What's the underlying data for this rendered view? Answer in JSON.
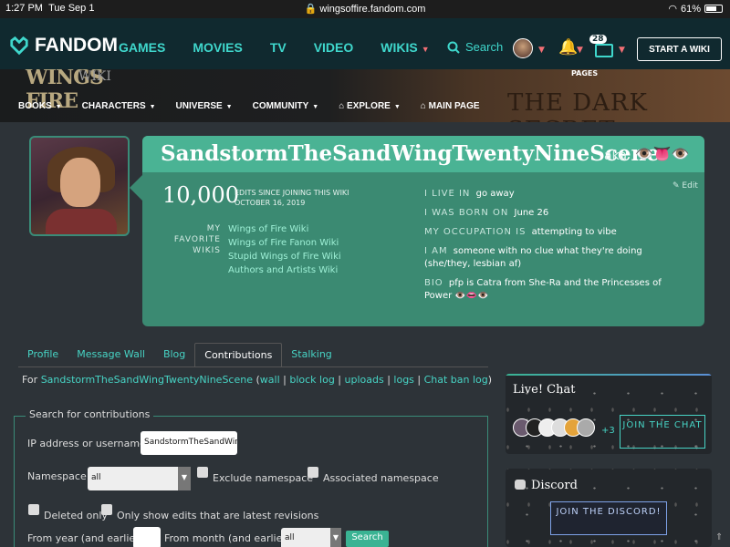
{
  "status_bar": {
    "time": "1:27 PM",
    "date": "Tue Sep 1",
    "url": "wingsoffire.fandom.com",
    "battery": "61%"
  },
  "fandom_bar": {
    "logo": "FANDOM",
    "nav": [
      "GAMES",
      "MOVIES",
      "TV",
      "VIDEO",
      "WIKIS"
    ],
    "search_label": "Search",
    "notifications_count": "28",
    "start_wiki": "START A WIKI"
  },
  "community": {
    "logo_top": "WINGS",
    "logo_bottom": "FIRE",
    "logo_wiki": "WIKI",
    "pages_label": "PAGES",
    "banner_text": "THE DARK SECRET",
    "nav": [
      "BOOKS",
      "CHARACTERS",
      "UNIVERSE",
      "COMMUNITY",
      "EXPLORE",
      "MAIN PAGE"
    ]
  },
  "profile": {
    "username": "SandstormTheSandWingTwentyNineScene",
    "aka": "aka",
    "aka_emoji": "👁️👅👁️",
    "edits_count": "10,000",
    "edits_label": "EDITS SINCE JOINING THIS WIKI",
    "join_date": "OCTOBER 16, 2019",
    "favorite_label": "MY FAVORITE WIKIS",
    "favorite_wikis": [
      "Wings of Fire Wiki",
      "Wings of Fire Fanon Wiki",
      "Stupid Wings of Fire Wiki",
      "Authors and Artists Wiki"
    ],
    "edit_link": "Edit",
    "facts": [
      {
        "key": "I LIVE IN",
        "value": "go away"
      },
      {
        "key": "I WAS BORN ON",
        "value": "June 26"
      },
      {
        "key": "MY OCCUPATION IS",
        "value": "attempting to vibe"
      },
      {
        "key": "I AM",
        "value": "someone with no clue what they're doing (she/they, lesbian af)"
      },
      {
        "key": "BIO",
        "value": "pfp is Catra from She-Ra and the Princesses of Power 👁️👄👁️"
      }
    ]
  },
  "tabs": [
    "Profile",
    "Message Wall",
    "Blog",
    "Contributions",
    "Stalking"
  ],
  "active_tab": "Contributions",
  "contributions": {
    "for_prefix": "For",
    "user_link": "SandstormTheSandWingTwentyNineScene",
    "open_paren": "(",
    "links": [
      "wall",
      "block log",
      "uploads",
      "logs",
      "Chat ban log"
    ],
    "close_paren": ")",
    "legend": "Search for contributions",
    "ip_label": "IP address or username:",
    "ip_value": "SandstormTheSandWing",
    "namespace_label": "Namespace:",
    "namespace_value": "all",
    "exclude_label": "Exclude namespace",
    "associated_label": "Associated namespace",
    "deleted_label": "Deleted only",
    "latest_label": "Only show edits that are latest revisions",
    "year_label": "From year (and earlier):",
    "month_label": "From month (and earlier):",
    "month_value": "all",
    "search_button": "Search"
  },
  "rail": {
    "chat_title": "Live! Chat",
    "chat_more": "+3",
    "join_chat": "JOIN THE CHAT",
    "discord_title": "Discord",
    "join_discord": "JOIN THE DISCORD!"
  },
  "colors": {
    "accent": "#3fd7cc",
    "brand_dark": "#10292f",
    "masthead": "#3b8a72",
    "masthead_title": "#4ab394",
    "pink": "#f36f75"
  }
}
